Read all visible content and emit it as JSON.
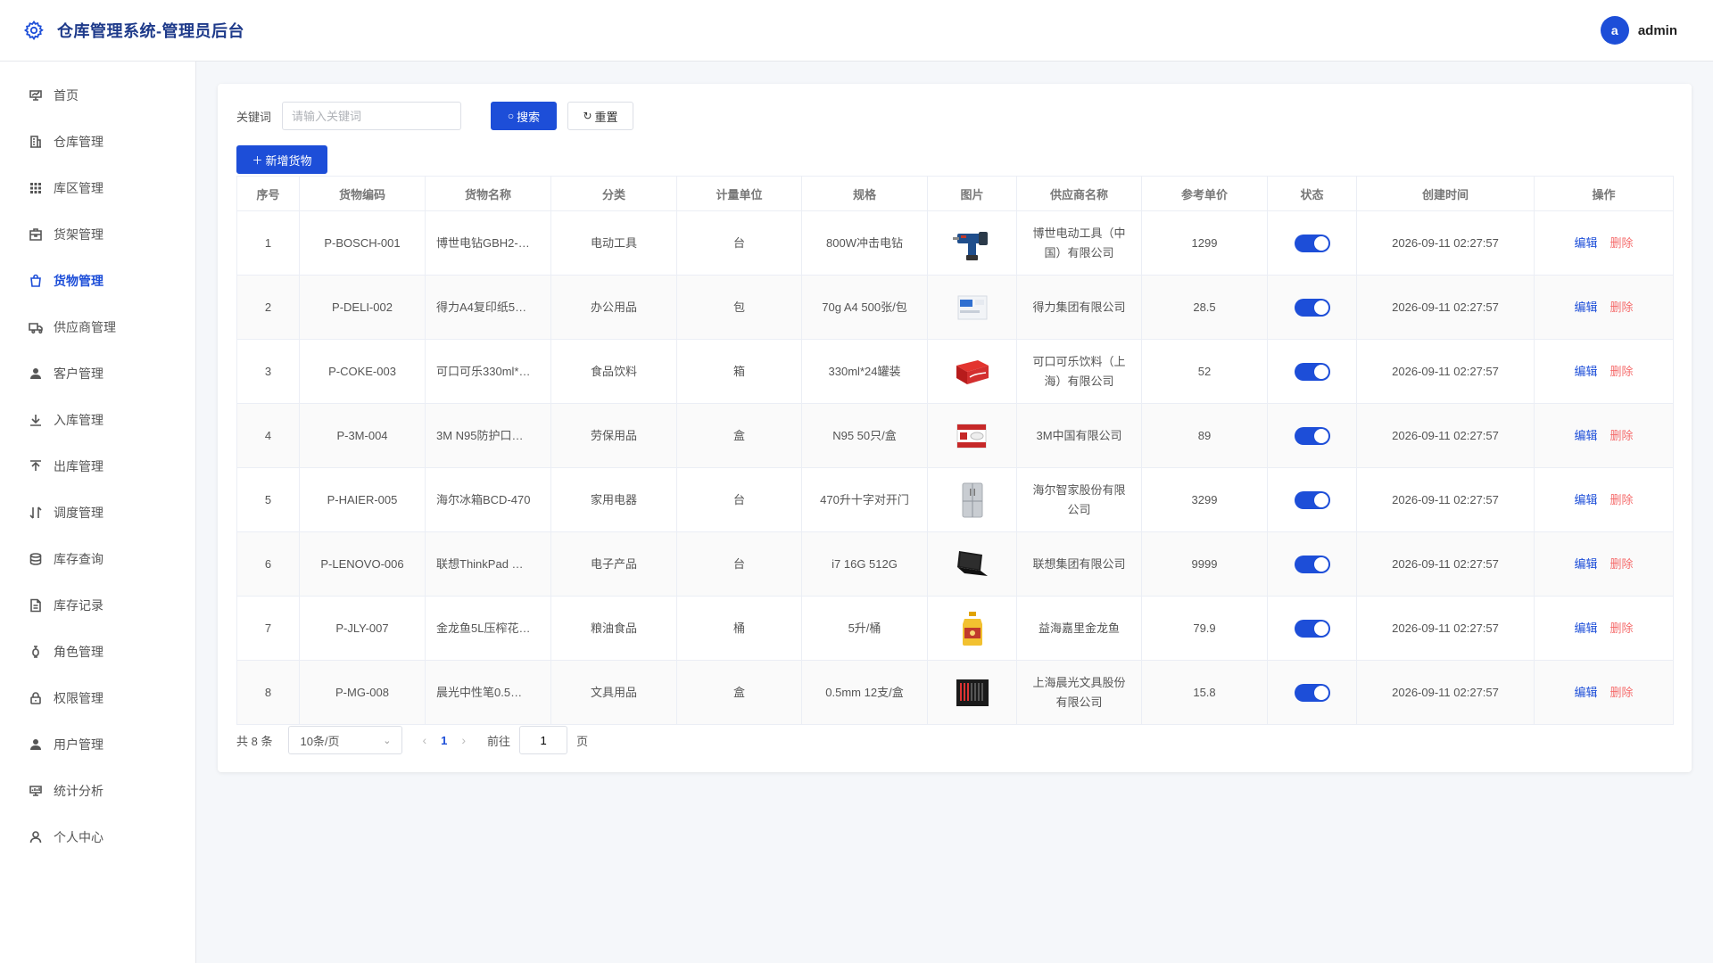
{
  "app": {
    "title": "仓库管理系统-管理员后台"
  },
  "user": {
    "avatar_letter": "a",
    "name": "admin"
  },
  "colors": {
    "primary": "#1d4ed8",
    "danger": "#f56c6c",
    "title": "#1e3a8a"
  },
  "sidebar": {
    "items": [
      {
        "label": "首页",
        "icon": "dashboard-icon"
      },
      {
        "label": "仓库管理",
        "icon": "building-icon"
      },
      {
        "label": "库区管理",
        "icon": "grid-icon"
      },
      {
        "label": "货架管理",
        "icon": "shelf-icon"
      },
      {
        "label": "货物管理",
        "icon": "bag-icon",
        "active": true
      },
      {
        "label": "供应商管理",
        "icon": "truck-icon"
      },
      {
        "label": "客户管理",
        "icon": "user-icon"
      },
      {
        "label": "入库管理",
        "icon": "download-icon"
      },
      {
        "label": "出库管理",
        "icon": "upload-icon"
      },
      {
        "label": "调度管理",
        "icon": "sort-icon"
      },
      {
        "label": "库存查询",
        "icon": "database-icon"
      },
      {
        "label": "库存记录",
        "icon": "document-icon"
      },
      {
        "label": "角色管理",
        "icon": "role-icon"
      },
      {
        "label": "权限管理",
        "icon": "lock-icon"
      },
      {
        "label": "用户管理",
        "icon": "user-filled-icon"
      },
      {
        "label": "统计分析",
        "icon": "chart-icon"
      },
      {
        "label": "个人中心",
        "icon": "person-icon"
      }
    ]
  },
  "search": {
    "label": "关键词",
    "placeholder": "请输入关键词",
    "value": "",
    "search_label": "搜索",
    "reset_label": "重置",
    "add_label": "新增货物"
  },
  "table": {
    "columns": [
      "序号",
      "货物编码",
      "货物名称",
      "分类",
      "计量单位",
      "规格",
      "图片",
      "供应商名称",
      "参考单价",
      "状态",
      "创建时间",
      "操作"
    ],
    "edit_label": "编辑",
    "delete_label": "删除",
    "rows": [
      {
        "no": "1",
        "code": "P-BOSCH-001",
        "name": "博世电钻GBH2-…",
        "category": "电动工具",
        "unit": "台",
        "spec": "800W冲击电钻",
        "image": "drill",
        "supplier": "博世电动工具（中国）有限公司",
        "price": "1299",
        "status": true,
        "created": "2026-09-11 02:27:57"
      },
      {
        "no": "2",
        "code": "P-DELI-002",
        "name": "得力A4复印纸5…",
        "category": "办公用品",
        "unit": "包",
        "spec": "70g A4 500张/包",
        "image": "paper",
        "supplier": "得力集团有限公司",
        "price": "28.5",
        "status": true,
        "created": "2026-09-11 02:27:57"
      },
      {
        "no": "3",
        "code": "P-COKE-003",
        "name": "可口可乐330ml*…",
        "category": "食品饮料",
        "unit": "箱",
        "spec": "330ml*24罐装",
        "image": "coke",
        "supplier": "可口可乐饮料（上海）有限公司",
        "price": "52",
        "status": true,
        "created": "2026-09-11 02:27:57"
      },
      {
        "no": "4",
        "code": "P-3M-004",
        "name": "3M N95防护口…",
        "category": "劳保用品",
        "unit": "盒",
        "spec": "N95 50只/盒",
        "image": "mask",
        "supplier": "3M中国有限公司",
        "price": "89",
        "status": true,
        "created": "2026-09-11 02:27:57"
      },
      {
        "no": "5",
        "code": "P-HAIER-005",
        "name": "海尔冰箱BCD-470",
        "category": "家用电器",
        "unit": "台",
        "spec": "470升十字对开门",
        "image": "fridge",
        "supplier": "海尔智家股份有限公司",
        "price": "3299",
        "status": true,
        "created": "2026-09-11 02:27:57"
      },
      {
        "no": "6",
        "code": "P-LENOVO-006",
        "name": "联想ThinkPad …",
        "category": "电子产品",
        "unit": "台",
        "spec": "i7 16G 512G",
        "image": "laptop",
        "supplier": "联想集团有限公司",
        "price": "9999",
        "status": true,
        "created": "2026-09-11 02:27:57"
      },
      {
        "no": "7",
        "code": "P-JLY-007",
        "name": "金龙鱼5L压榨花…",
        "category": "粮油食品",
        "unit": "桶",
        "spec": "5升/桶",
        "image": "oil",
        "supplier": "益海嘉里金龙鱼",
        "price": "79.9",
        "status": true,
        "created": "2026-09-11 02:27:57"
      },
      {
        "no": "8",
        "code": "P-MG-008",
        "name": "晨光中性笔0.5…",
        "category": "文具用品",
        "unit": "盒",
        "spec": "0.5mm 12支/盒",
        "image": "pens",
        "supplier": "上海晨光文具股份有限公司",
        "price": "15.8",
        "status": true,
        "created": "2026-09-11 02:27:57"
      }
    ]
  },
  "pagination": {
    "total_text": "共 8 条",
    "page_size": "10条/页",
    "current": "1",
    "goto_prefix": "前往",
    "goto_value": "1",
    "goto_suffix": "页"
  }
}
